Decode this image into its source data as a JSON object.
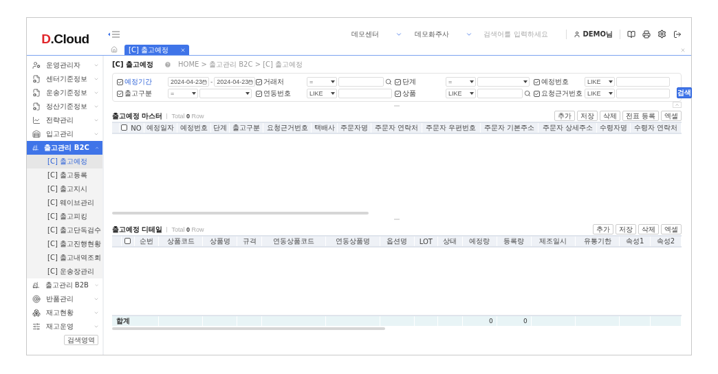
{
  "header": {
    "logo": {
      "mark": "D",
      "text": ".Cloud"
    },
    "selectors": [
      {
        "value": "데모센터"
      },
      {
        "value": "데모화주사"
      }
    ],
    "search": {
      "placeholder": "검색어를 입력하세요"
    },
    "user": "DEMO님"
  },
  "tabs": [
    {
      "label": "[C] 출고예정",
      "selected": true
    }
  ],
  "sidebar": {
    "items": [
      {
        "label": "운영관리자",
        "selected": false,
        "expanded": false
      },
      {
        "label": "센터기준정보",
        "selected": false,
        "expanded": false
      },
      {
        "label": "운송기준정보",
        "selected": false,
        "expanded": false
      },
      {
        "label": "정산기준정보",
        "selected": false,
        "expanded": false
      },
      {
        "label": "전략관리",
        "selected": false,
        "expanded": false
      },
      {
        "label": "입고관리",
        "selected": false,
        "expanded": false
      },
      {
        "label": "출고관리 B2C",
        "selected": true,
        "expanded": true,
        "children": [
          {
            "label": "[C] 출고예정",
            "selected": true
          },
          {
            "label": "[C] 출고등록",
            "selected": false
          },
          {
            "label": "[C] 출고지시",
            "selected": false
          },
          {
            "label": "[C] 웨이브관리",
            "selected": false
          },
          {
            "label": "[C] 출고피킹",
            "selected": false
          },
          {
            "label": "[C] 출고단독검수",
            "selected": false
          },
          {
            "label": "[C] 출고진행현황",
            "selected": false
          },
          {
            "label": "[C] 출고내역조회",
            "selected": false
          },
          {
            "label": "[C] 운송장관리",
            "selected": false
          }
        ]
      },
      {
        "label": "출고관리 B2B",
        "selected": false,
        "expanded": false
      },
      {
        "label": "반품관리",
        "selected": false,
        "expanded": false
      },
      {
        "label": "재고현황",
        "selected": false,
        "expanded": false
      },
      {
        "label": "재고운영",
        "selected": false,
        "expanded": false
      }
    ],
    "button": "검색영역"
  },
  "page": {
    "title": "[C] 출고예정",
    "breadcrumb": "HOME > 출고관리 B2C > [C] 출고예정"
  },
  "search_form": {
    "rows": [
      {
        "fields": [
          {
            "kind": "date-range",
            "label": "예정기간",
            "checked": true,
            "required": true,
            "from": "2024-04-23",
            "separator": "-",
            "to": "2024-04-23"
          },
          {
            "kind": "select-input",
            "label": "거래처",
            "checked": true,
            "required": false,
            "operator": "=",
            "lookup": true
          },
          {
            "kind": "select-pair",
            "label": "단계",
            "checked": true,
            "required": false,
            "operator": "="
          },
          {
            "kind": "select-input",
            "label": "예정번호",
            "checked": true,
            "required": false,
            "operator": "LIKE",
            "lookup": false
          }
        ]
      },
      {
        "fields": [
          {
            "kind": "select-pair",
            "label": "출고구분",
            "checked": true,
            "required": false,
            "operator": "="
          },
          {
            "kind": "select-input",
            "label": "연동번호",
            "checked": true,
            "required": false,
            "operator": "LIKE",
            "lookup": false
          },
          {
            "kind": "select-input",
            "label": "상품",
            "checked": true,
            "required": false,
            "operator": "LIKE",
            "lookup": true
          },
          {
            "kind": "select-input",
            "label": "요청근거번호",
            "checked": true,
            "required": false,
            "operator": "LIKE",
            "lookup": false
          }
        ]
      }
    ],
    "submit": "검색"
  },
  "master": {
    "title": "출고예정 마스터",
    "count": "Total **0** Row",
    "buttons": [
      "추가",
      "저장",
      "삭제",
      "전표 등록",
      "엑셀"
    ],
    "select_all": {
      "checked": false
    },
    "columns": [
      {
        "label": "NO"
      },
      {
        "label": "예정일자"
      },
      {
        "label": "예정번호"
      },
      {
        "label": "단계"
      },
      {
        "label": "출고구분"
      },
      {
        "label": "요청근거번호"
      },
      {
        "label": "택배사"
      },
      {
        "label": "주문자명"
      },
      {
        "label": "주문자 연락처"
      },
      {
        "label": "주문자 우편번호"
      },
      {
        "label": "주문자 기본주소"
      },
      {
        "label": "주문자 상세주소"
      },
      {
        "label": "수령자명"
      },
      {
        "label": "수령자 연락처"
      }
    ]
  },
  "detail": {
    "title": "출고예정 디테일",
    "count": "Total **0** Row",
    "buttons": [
      "추가",
      "저장",
      "삭제",
      "엑셀"
    ],
    "select_all": {
      "checked": false
    },
    "total_label": "합계",
    "columns": [
      {
        "label": "순번"
      },
      {
        "label": "상품코드"
      },
      {
        "label": "상품명"
      },
      {
        "label": "규격"
      },
      {
        "label": "연동상품코드"
      },
      {
        "label": "연동상품명"
      },
      {
        "label": "옵션명"
      },
      {
        "label": "LOT"
      },
      {
        "label": "상태"
      },
      {
        "label": "예정량",
        "total": "0"
      },
      {
        "label": "등록량",
        "total": "0"
      },
      {
        "label": "제조일시"
      },
      {
        "label": "유통기한"
      },
      {
        "label": "속성1"
      },
      {
        "label": "속성2"
      }
    ]
  }
}
